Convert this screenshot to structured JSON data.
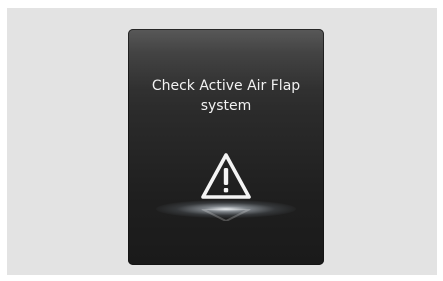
{
  "screen": {
    "message_line1": "Check Active Air Flap",
    "message_line2": "system"
  },
  "icons": {
    "warning": "warning-triangle-icon"
  },
  "colors": {
    "background": "#e3e3e3",
    "panel": "#2b2b2b",
    "text": "#f2f2f2"
  }
}
